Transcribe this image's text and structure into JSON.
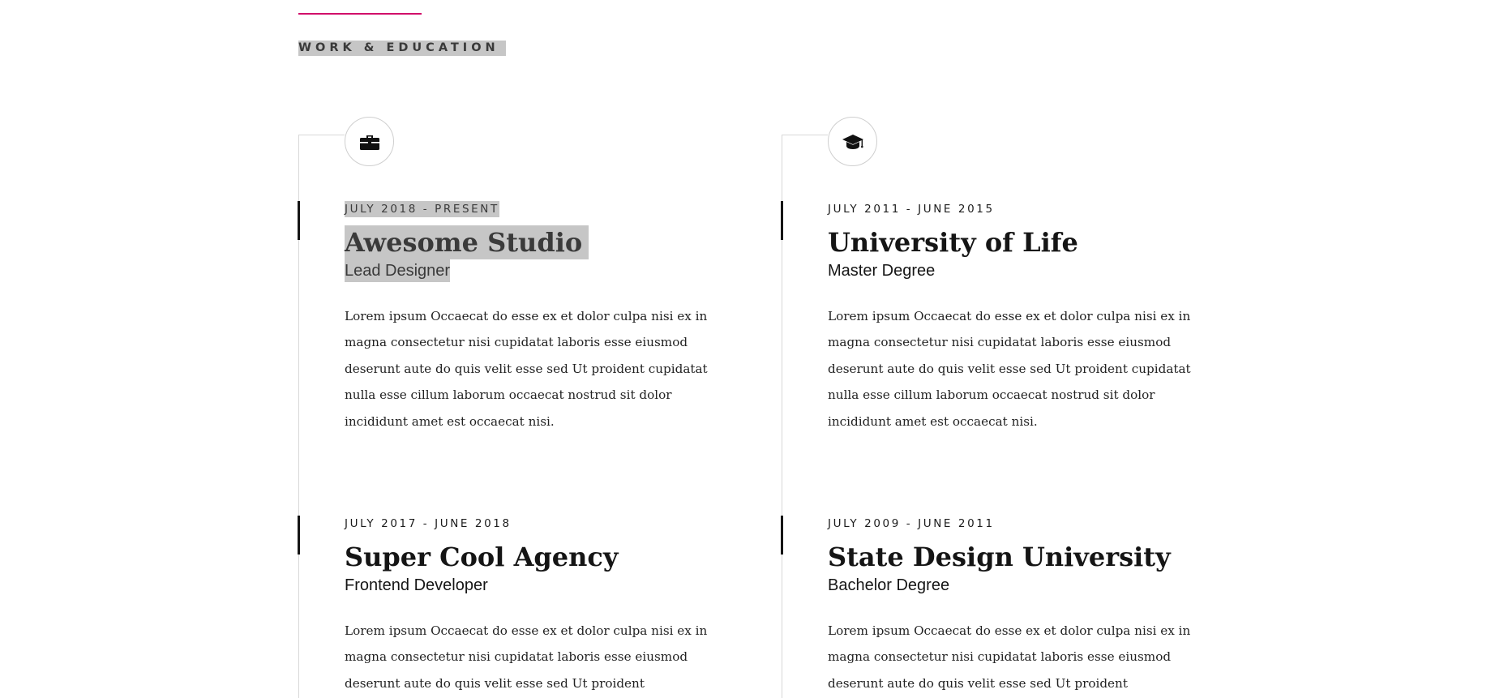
{
  "section": {
    "label": "WORK & EDUCATION"
  },
  "colors": {
    "accent": "#d10a6a",
    "selection_highlight": "#c6c6c6",
    "text": "#151515",
    "timeline_line": "#d8d8d8"
  },
  "work": {
    "icon": "briefcase-icon",
    "entries": [
      {
        "date": "JULY 2018 - PRESENT",
        "title": "Awesome Studio",
        "role": "Lead Designer",
        "description": "Lorem ipsum Occaecat do esse ex et dolor culpa nisi ex in magna consectetur nisi cupidatat laboris esse eiusmod deserunt aute do quis velit esse sed Ut proident cupidatat nulla esse cillum laborum occaecat nostrud sit dolor incididunt amet est occaecat nisi."
      },
      {
        "date": "JULY 2017 - JUNE 2018",
        "title": "Super Cool Agency",
        "role": "Frontend Developer",
        "description": "Lorem ipsum Occaecat do esse ex et dolor culpa nisi ex in magna consectetur nisi cupidatat laboris esse eiusmod deserunt aute do quis velit esse sed Ut proident"
      }
    ]
  },
  "education": {
    "icon": "graduation-cap-icon",
    "entries": [
      {
        "date": "JULY 2011 - JUNE 2015",
        "title": "University of Life",
        "role": "Master Degree",
        "description": "Lorem ipsum Occaecat do esse ex et dolor culpa nisi ex in magna consectetur nisi cupidatat laboris esse eiusmod deserunt aute do quis velit esse sed Ut proident cupidatat nulla esse cillum laborum occaecat nostrud sit dolor incididunt amet est occaecat nisi."
      },
      {
        "date": "JULY 2009 - JUNE 2011",
        "title": "State Design University",
        "role": "Bachelor Degree",
        "description": "Lorem ipsum Occaecat do esse ex et dolor culpa nisi ex in magna consectetur nisi cupidatat laboris esse eiusmod deserunt aute do quis velit esse sed Ut proident"
      }
    ]
  }
}
